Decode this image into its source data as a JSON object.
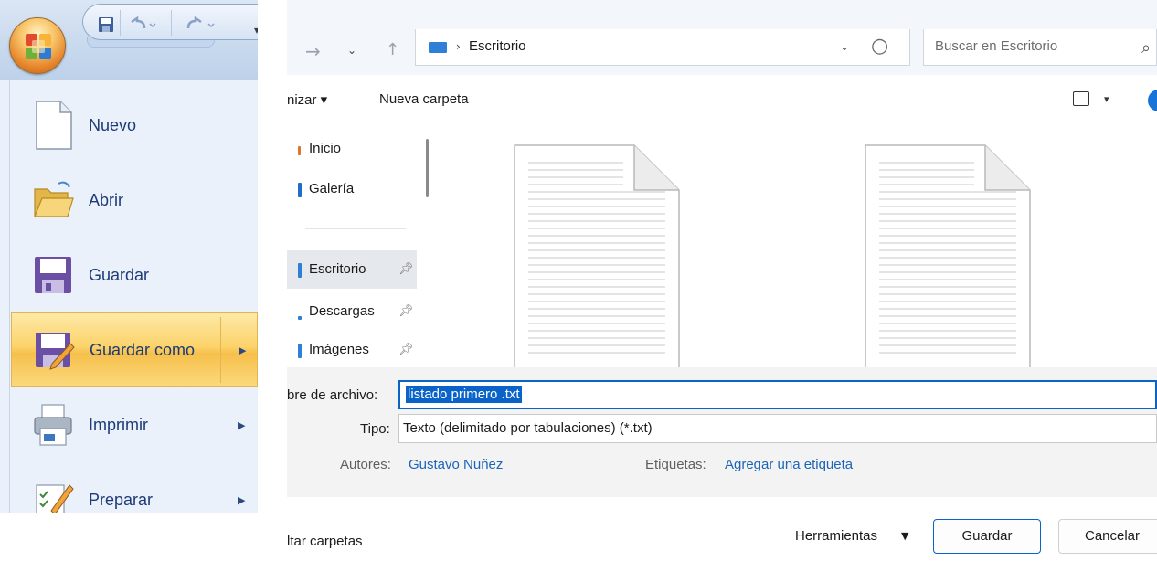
{
  "office_menu": {
    "quick_access": {
      "save_icon": "save-icon",
      "undo_icon": "undo-icon",
      "redo_icon": "redo-icon"
    },
    "items": [
      {
        "label": "Nuevo",
        "icon": "new-document-icon",
        "has_submenu": false
      },
      {
        "label": "Abrir",
        "icon": "open-folder-icon",
        "has_submenu": false
      },
      {
        "label": "Guardar",
        "icon": "save-icon",
        "has_submenu": false
      },
      {
        "label": "Guardar como",
        "icon": "save-as-icon",
        "has_submenu": true,
        "active": true
      },
      {
        "label": "Imprimir",
        "icon": "printer-icon",
        "has_submenu": true
      },
      {
        "label": "Preparar",
        "icon": "prepare-icon",
        "has_submenu": true
      }
    ],
    "colors": {
      "active_highlight": "#fcd36b",
      "label_text": "#1d3b78"
    }
  },
  "dialog": {
    "address": {
      "path": "Escritorio"
    },
    "search": {
      "placeholder": "Buscar en Escritorio"
    },
    "toolbar": {
      "organize_label": "nizar",
      "new_folder_label": "Nueva carpeta"
    },
    "nav_pane": {
      "items": [
        {
          "label": "Inicio",
          "pinned": false
        },
        {
          "label": "Galería",
          "pinned": false
        },
        {
          "label": "Escritorio",
          "pinned": true,
          "selected": true
        },
        {
          "label": "Descargas",
          "pinned": true
        },
        {
          "label": "Imágenes",
          "pinned": true
        }
      ]
    },
    "form": {
      "filename_label": "bre de archivo:",
      "filename_value": "listado primero .txt",
      "type_label": "Tipo:",
      "type_value": "Texto (delimitado por tabulaciones) (*.txt)",
      "authors_label": "Autores:",
      "authors_value": "Gustavo Nuñez",
      "tags_label": "Etiquetas:",
      "tags_value": "Agregar una etiqueta"
    },
    "footer": {
      "hide_folders_label": "ltar carpetas",
      "tools_label": "Herramientas",
      "save_label": "Guardar",
      "cancel_label": "Cancelar"
    },
    "colors": {
      "accent": "#0a63c9",
      "link": "#1c64b8"
    }
  }
}
